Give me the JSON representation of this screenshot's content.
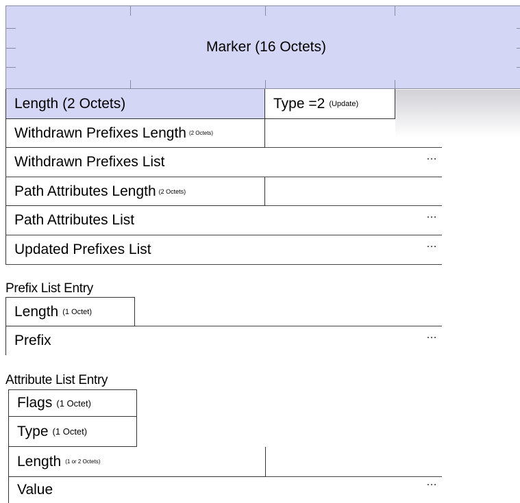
{
  "marker": {
    "label": "Marker (16 Octets)"
  },
  "header": {
    "length_label": "Length (2 Octets)",
    "type_label": "Type =2",
    "type_note": "(Update)"
  },
  "fields": {
    "withdrawn_length": {
      "label": "Withdrawn Prefixes Length",
      "note": "(2 Octets)"
    },
    "withdrawn_list": {
      "label": "Withdrawn Prefixes List"
    },
    "path_attr_length": {
      "label": "Path Attributes Length",
      "note": "(2 Octets)"
    },
    "path_attr_list": {
      "label": "Path Attributes List"
    },
    "updated_list": {
      "label": "Updated Prefixes List"
    }
  },
  "ellipsis": "…",
  "prefix_entry": {
    "title": "Prefix List Entry",
    "length": {
      "label": "Length",
      "note": "(1 Octet)"
    },
    "prefix": {
      "label": "Prefix"
    }
  },
  "attribute_entry": {
    "title": "Attribute List Entry",
    "flags": {
      "label": "Flags",
      "note": "(1 Octet)"
    },
    "type": {
      "label": "Type",
      "note": "(1 Octet)"
    },
    "length": {
      "label": "Length",
      "note": "(1 or 2 Octets)"
    },
    "value": {
      "label": "Value"
    }
  },
  "colors": {
    "marker_fill": "#d4d6f5",
    "line": "#333333"
  }
}
